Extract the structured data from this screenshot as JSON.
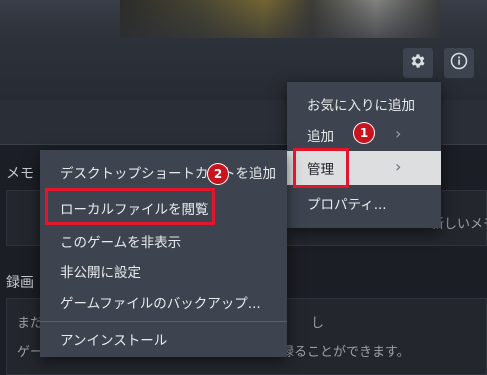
{
  "sections": {
    "memo_label": "メモ",
    "recording_label": "録画"
  },
  "memo_panel": {
    "text_partial": "新しいメモ"
  },
  "recording_panel": {
    "line1": "まだ",
    "line1_tail": "し",
    "line2": "ゲー",
    "line2_tail": "録ることができます。"
  },
  "gear_menu": {
    "items": [
      {
        "label": "お気に入りに追加"
      },
      {
        "label": "追加"
      },
      {
        "label": "管理"
      },
      {
        "label": "プロパティ..."
      }
    ]
  },
  "manage_submenu": {
    "items": [
      {
        "label": "デスクトップショートカットを追加"
      },
      {
        "label": "ローカルファイルを閲覧"
      },
      {
        "label": "このゲームを非表示"
      },
      {
        "label": "非公開に設定"
      },
      {
        "label": "ゲームファイルのバックアップ..."
      },
      {
        "label": "アンインストール"
      }
    ]
  },
  "markers": {
    "step1": "1",
    "step2": "2"
  },
  "icons": {
    "settings": "gear-icon",
    "info": "info-icon",
    "submenu_arrow": "chevron-right-icon"
  },
  "colors": {
    "highlight": "#e3152b",
    "marker": "#c8141f",
    "menu_bg": "#3d4450",
    "hover_bg": "#dcdedf"
  }
}
